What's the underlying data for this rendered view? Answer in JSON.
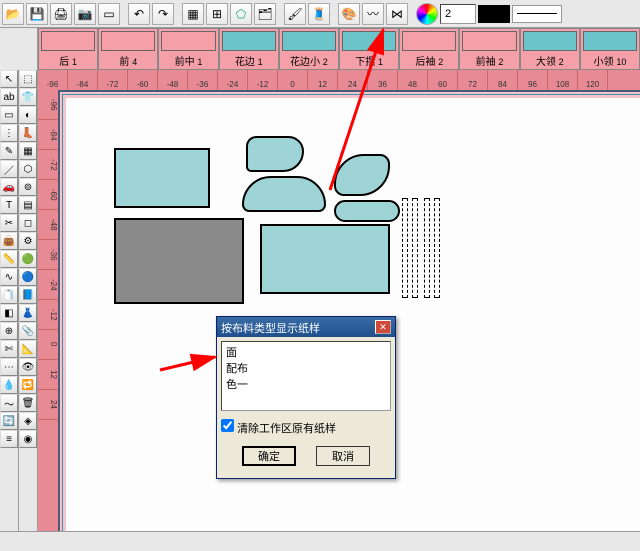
{
  "toolbar": {
    "input_value": "2"
  },
  "panels": [
    {
      "label": "后",
      "count": "1",
      "cls": "pink"
    },
    {
      "label": "前",
      "count": "4",
      "cls": "pink"
    },
    {
      "label": "前中",
      "count": "1",
      "cls": "pink"
    },
    {
      "label": "花边",
      "count": "1",
      "cls": "teal"
    },
    {
      "label": "花边小",
      "count": "2",
      "cls": "teal"
    },
    {
      "label": "下摆",
      "count": "1",
      "cls": "teal"
    },
    {
      "label": "后袖",
      "count": "2",
      "cls": "pink"
    },
    {
      "label": "前袖",
      "count": "2",
      "cls": "pink"
    },
    {
      "label": "大领",
      "count": "2",
      "cls": "teal"
    },
    {
      "label": "小领",
      "count": "10",
      "cls": "teal"
    }
  ],
  "ruler_top": [
    "-96",
    "-84",
    "-72",
    "-60",
    "-48",
    "-36",
    "-24",
    "-12",
    "0",
    "12",
    "24",
    "36",
    "48",
    "60",
    "72",
    "84",
    "96",
    "108",
    "120"
  ],
  "ruler_left": [
    "-96",
    "-84",
    "-72",
    "-60",
    "-48",
    "-36",
    "-24",
    "-12",
    "0",
    "12",
    "24"
  ],
  "dialog": {
    "title": "按布料类型显示纸样",
    "items": [
      "面",
      "配布",
      "色一"
    ],
    "checkbox_label": "清除工作区原有纸样",
    "ok": "确定",
    "cancel": "取消"
  }
}
